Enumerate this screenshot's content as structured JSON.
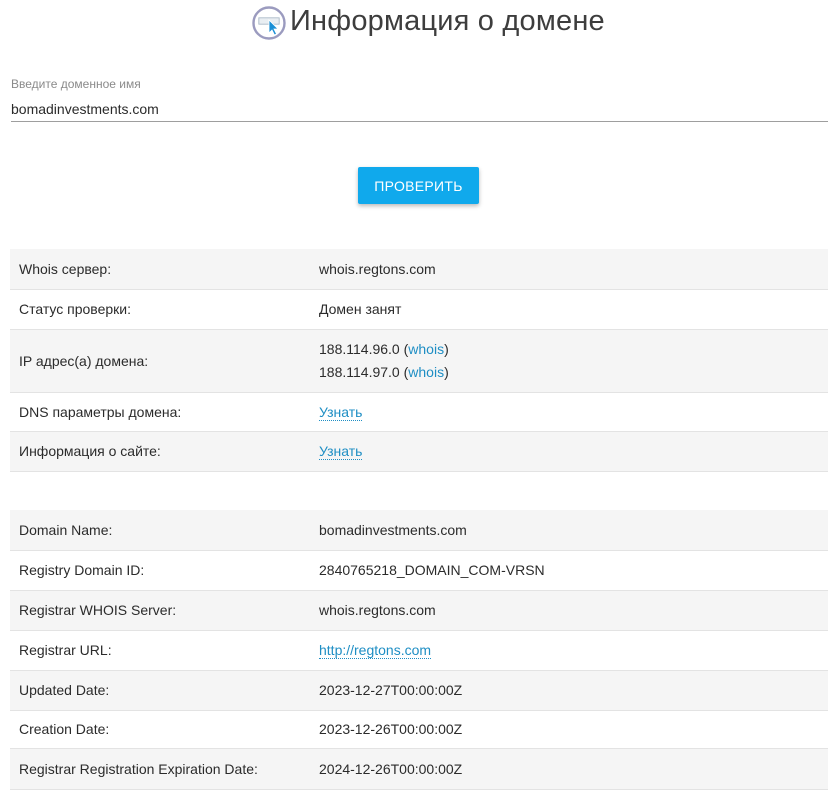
{
  "header": {
    "title": "Информация о домене"
  },
  "search": {
    "label": "Введите доменное имя",
    "value": "bomadinvestments.com",
    "button_label": "ПРОВЕРИТЬ"
  },
  "summary": {
    "whois_server": {
      "label": "Whois сервер:",
      "value": "whois.regtons.com"
    },
    "status": {
      "label": "Статус проверки:",
      "value": "Домен занят"
    },
    "ip": {
      "label": "IP адрес(а) домена:",
      "addresses": [
        {
          "ip": "188.114.96.0",
          "link": "whois"
        },
        {
          "ip": "188.114.97.0",
          "link": "whois"
        }
      ]
    },
    "dns": {
      "label": "DNS параметры домена:",
      "link": "Узнать"
    },
    "site": {
      "label": "Информация о сайте:",
      "link": "Узнать"
    }
  },
  "whois": {
    "rows": [
      {
        "label": "Domain Name:",
        "value": "bomadinvestments.com"
      },
      {
        "label": "Registry Domain ID:",
        "value": "2840765218_DOMAIN_COM-VRSN"
      },
      {
        "label": "Registrar WHOIS Server:",
        "value": "whois.regtons.com"
      },
      {
        "label": "Registrar URL:",
        "value": "http://regtons.com"
      },
      {
        "label": "Updated Date:",
        "value": "2023-12-27T00:00:00Z"
      },
      {
        "label": "Creation Date:",
        "value": "2023-12-26T00:00:00Z"
      },
      {
        "label": "Registrar Registration Expiration Date:",
        "value": "2024-12-26T00:00:00Z"
      }
    ]
  },
  "colors": {
    "accent": "#10a9ec",
    "link": "#1e8ec4",
    "row_shade": "#f5f5f5"
  }
}
